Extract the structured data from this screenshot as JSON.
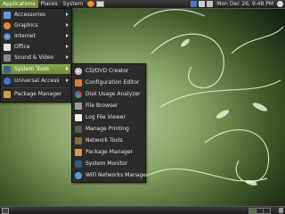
{
  "top_panel": {
    "menus": [
      "Applications",
      "Places",
      "System"
    ],
    "clock": "Mon Dec 26,  9:48 PM"
  },
  "applications_menu": {
    "items": [
      {
        "label": "Accessories",
        "icon": "accessories-icon",
        "submenu": true
      },
      {
        "label": "Graphics",
        "icon": "graphics-icon",
        "submenu": true
      },
      {
        "label": "Internet",
        "icon": "internet-icon",
        "submenu": true
      },
      {
        "label": "Office",
        "icon": "office-icon",
        "submenu": true
      },
      {
        "label": "Sound & Video",
        "icon": "sound-video-icon",
        "submenu": true
      },
      {
        "label": "System Tools",
        "icon": "system-tools-icon",
        "submenu": true,
        "highlighted": true
      },
      {
        "label": "Universal Access",
        "icon": "universal-access-icon",
        "submenu": true
      },
      {
        "label": "Package Manager",
        "icon": "package-manager-icon",
        "submenu": false
      }
    ]
  },
  "system_tools_menu": {
    "items": [
      {
        "label": "CD/DVD Creator",
        "icon": "disc-icon"
      },
      {
        "label": "Configuration Editor",
        "icon": "config-editor-icon"
      },
      {
        "label": "Disk Usage Analyzer",
        "icon": "disk-usage-icon"
      },
      {
        "label": "File Browser",
        "icon": "file-browser-icon"
      },
      {
        "label": "Log File Viewer",
        "icon": "log-viewer-icon"
      },
      {
        "label": "Manage Printing",
        "icon": "printer-icon"
      },
      {
        "label": "Network Tools",
        "icon": "network-tools-icon"
      },
      {
        "label": "Package Manager",
        "icon": "package-manager-icon"
      },
      {
        "label": "System Monitor",
        "icon": "system-monitor-icon"
      },
      {
        "label": "WiFi Networks Manager",
        "icon": "wifi-icon"
      }
    ]
  },
  "colors": {
    "highlight": "#7a9a44",
    "panel": "#2a2a2a",
    "menu_bg": "#2b2b2b",
    "wallpaper_light": "#9cb57a",
    "wallpaper_dark": "#1a2a10"
  }
}
